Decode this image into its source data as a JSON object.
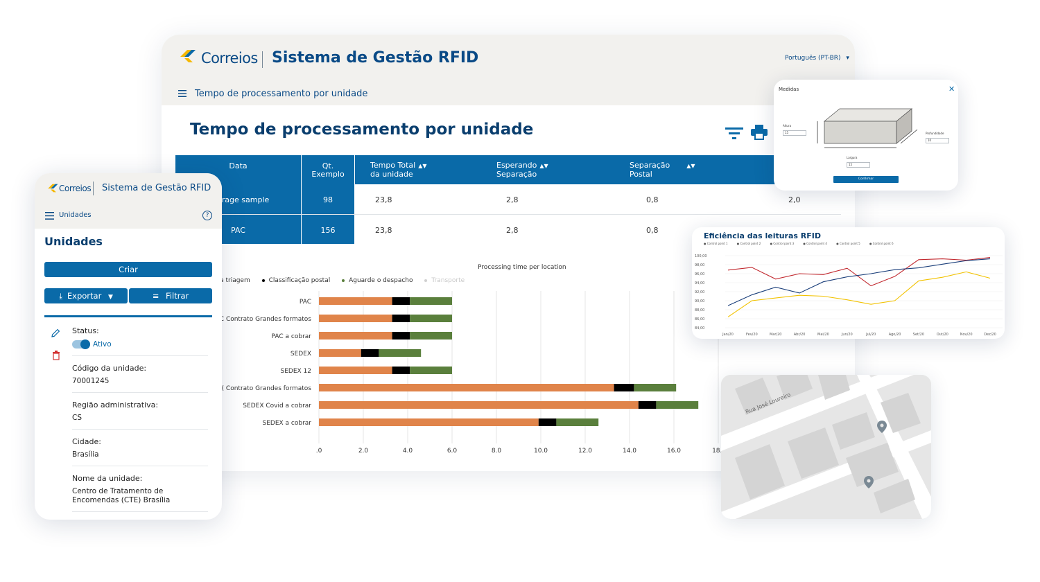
{
  "brand": {
    "logo_text": "Correios",
    "system_title": "Sistema de Gestão RFID"
  },
  "main": {
    "language": "Português (PT-BR)",
    "breadcrumb": "Tempo de processamento por unidade",
    "page_title": "Tempo de processamento por unidade",
    "table": {
      "headers": [
        {
          "line1": "Data",
          "line2": ""
        },
        {
          "line1": "Qt.",
          "line2": "Exemplo"
        },
        {
          "line1": "Tempo Total",
          "line2": "da unidade"
        },
        {
          "line1": "Esperando",
          "line2": "Separação"
        },
        {
          "line1": "Separação",
          "line2": "Postal"
        }
      ],
      "rows": [
        {
          "label": "erage sample",
          "qt": "98",
          "total": "23,8",
          "esperando": "2,8",
          "separacao": "0,8",
          "extra": "2,0"
        },
        {
          "label": "PAC",
          "qt": "156",
          "total": "23,8",
          "esperando": "2,8",
          "separacao": "0,8",
          "extra": ""
        }
      ]
    }
  },
  "chart_data": [
    {
      "type": "bar",
      "orientation": "horizontal",
      "stacked": true,
      "title": "Processing time per location",
      "categories": [
        "PAC",
        "C Contrato Grandes formatos",
        "PAC a cobrar",
        "SEDEX",
        "SEDEX 12",
        "( Contrato Grandes formatos",
        "SEDEX Covid a cobrar",
        "SEDEX a cobrar"
      ],
      "series": [
        {
          "name": "a da triagem",
          "color": "#e0844a",
          "values": [
            3.3,
            3.3,
            3.3,
            1.9,
            3.3,
            13.3,
            14.4,
            9.9
          ]
        },
        {
          "name": "Classificação postal",
          "color": "#000000",
          "values": [
            0.8,
            0.8,
            0.8,
            0.8,
            0.8,
            0.9,
            0.8,
            0.8
          ]
        },
        {
          "name": "Aguarde o despacho",
          "color": "#5a7f3c",
          "values": [
            1.9,
            1.9,
            1.9,
            1.9,
            1.9,
            1.9,
            1.9,
            1.9
          ]
        },
        {
          "name": "Transporte",
          "color": "#d0d0d0",
          "values": [
            0,
            0,
            0,
            0,
            0,
            0,
            0,
            0
          ]
        }
      ],
      "x_ticks": [
        ".0",
        "2.0",
        "4.0",
        "6.0",
        "8.0",
        "10.0",
        "12.0",
        "14.0",
        "16.0",
        "18.("
      ],
      "xlim": [
        0,
        18
      ],
      "grid": true,
      "legend": "top"
    },
    {
      "type": "line",
      "title": "Eficiência das leituras RFID",
      "categories": [
        "Jan/20",
        "Fev/20",
        "Mar/20",
        "Abr/20",
        "Mai/20",
        "Jun/20",
        "Jul/20",
        "Ago/20",
        "Set/20",
        "Out/20",
        "Nov/20",
        "Dez/20"
      ],
      "y_ticks": [
        "100,00",
        "98,00",
        "96,00",
        "94,00",
        "92,00",
        "90,00",
        "88,00",
        "86,00",
        "84,00"
      ],
      "ylim": [
        84,
        100
      ],
      "series": [
        {
          "name": "Control point 1",
          "color": "#c1272d",
          "values": [
            96.8,
            97.4,
            94.8,
            96.0,
            95.8,
            97.2,
            93.3,
            95.4,
            99.1,
            99.3,
            99.0,
            99.6
          ]
        },
        {
          "name": "Control point 2",
          "color": "#f2c200",
          "values": [
            86.4,
            90.0,
            90.6,
            91.2,
            91.0,
            90.2,
            89.2,
            90.0,
            94.4,
            95.2,
            96.4,
            95.0
          ]
        },
        {
          "name": "Control point 3",
          "color": "#1a3e7a",
          "values": [
            88.9,
            91.3,
            93.0,
            91.7,
            94.2,
            95.3,
            96.0,
            96.9,
            97.3,
            98.1,
            98.9,
            99.3
          ]
        }
      ],
      "legend_labels": [
        "Control point 1",
        "Control point 2",
        "Control point 3",
        "Control point 4",
        "Control point 5",
        "Control point 6"
      ],
      "legend": "top"
    }
  ],
  "mobile": {
    "logo_text": "Correios",
    "system_title": "Sistema de Gestão RFID",
    "breadcrumb": "Unidades",
    "help": "?",
    "title": "Unidades",
    "create_label": "Criar",
    "export_label": "Exportar",
    "filter_label": "Filtrar",
    "fields": {
      "status_label": "Status:",
      "status_value": "Ativo",
      "codigo_label": "Código da unidade:",
      "codigo_value": "70001245",
      "regiao_label": "Região administrativa:",
      "regiao_value": "CS",
      "cidade_label": "Cidade:",
      "cidade_value": "Brasília",
      "nome_label": "Nome da unidade:",
      "nome_value_1": "Centro de Tratamento de",
      "nome_value_2": "Encomendas (CTE) Brasília"
    }
  },
  "medidas": {
    "title": "Medidas",
    "close": "✕",
    "altura_label": "Altura",
    "altura_value": "15",
    "largura_label": "Largura",
    "largura_value": "15",
    "profundidade_label": "Profundidade",
    "profundidade_value": "10",
    "confirm_label": "Confirmar"
  },
  "map": {
    "street": "Rua José Loureiro"
  },
  "colors": {
    "brand_blue": "#0a6aa8",
    "dark_blue": "#0a3e6e",
    "logo_yellow": "#f5b800"
  }
}
